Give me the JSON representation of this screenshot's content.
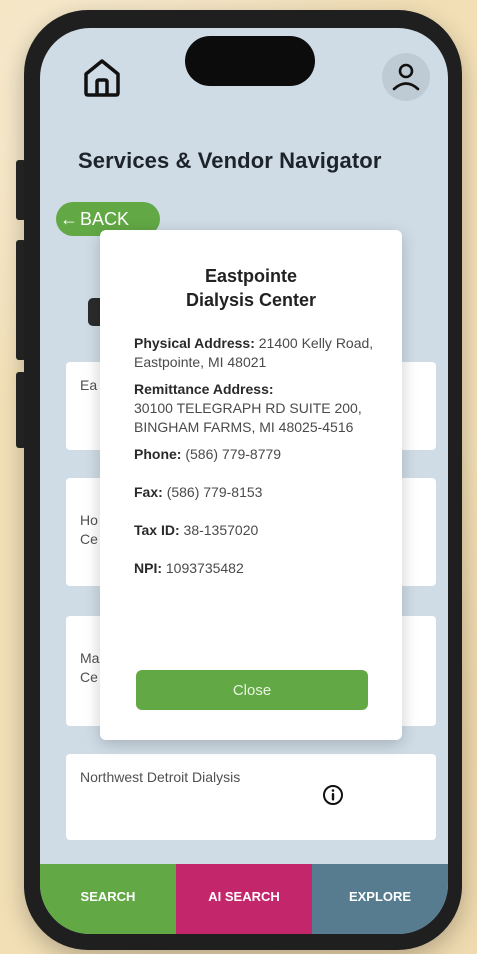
{
  "app": {
    "title": "Services & Vendor Navigator",
    "back_label": "BACK"
  },
  "icons": {
    "home": "home-icon",
    "profile": "user-icon",
    "back": "arrow-left-icon",
    "info": "info-circle-icon"
  },
  "colors": {
    "primary_green": "#62a845",
    "ai_magenta": "#c4266c",
    "explore_slate": "#577c90",
    "screen_bg": "#cfdce6"
  },
  "list": {
    "items": [
      {
        "label": "Ea"
      },
      {
        "label": "Ho\nCe"
      },
      {
        "label": "Ma\nCe"
      },
      {
        "label": "Northwest Detroit Dialysis"
      }
    ]
  },
  "modal": {
    "title": "Eastpointe\nDialysis Center",
    "physical_label": "Physical Address:",
    "physical_value": "21400 Kelly Road, Eastpointe, MI 48021",
    "remit_label": "Remittance Address:",
    "remit_value": "30100 TELEGRAPH RD SUITE 200, BINGHAM FARMS, MI 48025-4516",
    "phone_label": "Phone:",
    "phone_value": "(586) 779-8779",
    "fax_label": "Fax:",
    "fax_value": "(586) 779-8153",
    "tax_label": "Tax ID:",
    "tax_value": "38-1357020",
    "npi_label": "NPI:",
    "npi_value": "1093735482",
    "close_label": "Close"
  },
  "nav": {
    "search": "SEARCH",
    "ai_search": "AI SEARCH",
    "explore": "EXPLORE"
  }
}
